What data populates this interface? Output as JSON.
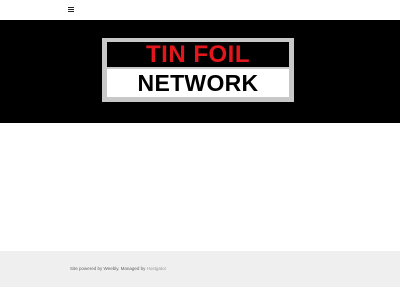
{
  "header": {
    "menu_icon": "hamburger-menu-icon"
  },
  "hero": {
    "logo_line1": "TIN FOIL",
    "logo_line2": "NETWORK",
    "colors": {
      "background": "#000000",
      "logo_red": "#e3171b",
      "logo_frame": "#c8c8c8"
    }
  },
  "footer": {
    "powered_text": "Site powered by Weebly. Managed by ",
    "manager_link": "Hostgator",
    "background": "#efefef"
  }
}
